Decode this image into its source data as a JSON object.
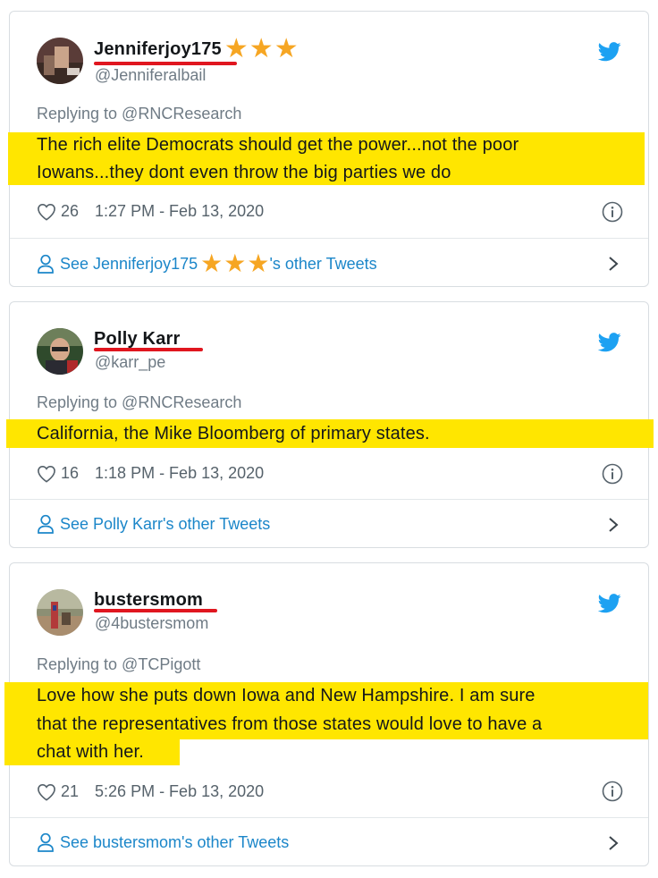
{
  "colors": {
    "highlight": "#ffe600",
    "underline_red": "#e0161f",
    "twitter_blue": "#1da1f2",
    "link_blue": "#1b86c9",
    "star": "#f6a623"
  },
  "tweets": [
    {
      "name": "Jenniferjoy175",
      "name_suffix": "★★★",
      "handle": "@Jenniferalbail",
      "replying": "Replying to @RNCResearch",
      "lines": [
        "The rich elite Democrats should get the power...not the poor",
        "Iowans...they dont even throw the big parties we do"
      ],
      "likes": "26",
      "timestamp": "1:27 PM - Feb 13, 2020",
      "see_prefix": "See Jenniferjoy175",
      "see_suffix": "'s other Tweets"
    },
    {
      "name": "Polly Karr",
      "handle": "@karr_pe",
      "replying": "Replying to @RNCResearch",
      "lines": [
        "California, the Mike Bloomberg of primary states."
      ],
      "likes": "16",
      "timestamp": "1:18 PM - Feb 13, 2020",
      "see_prefix": "See Polly Karr's other Tweets"
    },
    {
      "name": "bustersmom",
      "handle": "@4bustersmom",
      "replying": "Replying to @TCPigott",
      "lines": [
        "Love how she puts down Iowa and New Hampshire. I am sure",
        "that the representatives from those states would love to have a",
        "chat with her."
      ],
      "likes": "21",
      "timestamp": "5:26 PM - Feb 13, 2020",
      "see_prefix": "See bustersmom's other Tweets"
    }
  ]
}
